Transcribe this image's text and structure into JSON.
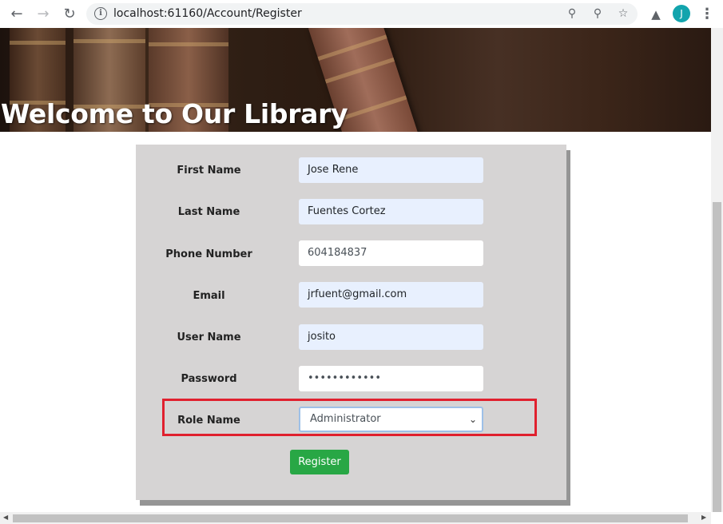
{
  "browser": {
    "url": "localhost:61160/Account/Register",
    "avatar_initial": "J",
    "icons": [
      "back-icon",
      "forward-icon",
      "reload-icon",
      "info-icon",
      "key-icon",
      "zoom-icon",
      "star-icon",
      "extensions-icon",
      "menu-icon"
    ]
  },
  "banner": {
    "title": "Welcome to Our Library"
  },
  "form": {
    "fields": [
      {
        "label": "First Name",
        "value": "Jose Rene"
      },
      {
        "label": "Last Name",
        "value": "Fuentes Cortez"
      },
      {
        "label": "Phone Number",
        "value": "604184837"
      },
      {
        "label": "Email",
        "value": "jrfuent@gmail.com"
      },
      {
        "label": "User Name",
        "value": "josito"
      },
      {
        "label": "Password",
        "value": "••••••••••••"
      }
    ],
    "role": {
      "label": "Role Name",
      "selected": "Administrator"
    },
    "register_label": "Register"
  },
  "colors": {
    "register_button": "#28a745",
    "highlight_border": "#e0202e",
    "card_background": "#d6d4d4",
    "autofill_background": "#e8f0fe"
  }
}
